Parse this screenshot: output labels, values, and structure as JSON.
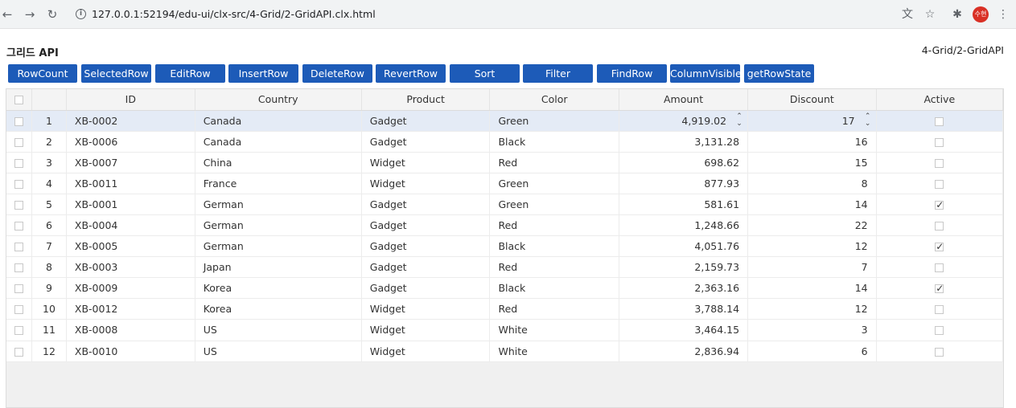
{
  "browser": {
    "url": "127.0.0.1:52194/edu-ui/clx-src/4-Grid/2-GridAPI.clx.html",
    "profile_initials": "수현",
    "icons": [
      "back-icon",
      "forward-icon",
      "reload-icon",
      "info-icon",
      "translate-icon",
      "star-icon",
      "extensions-icon",
      "menu-icon"
    ]
  },
  "page": {
    "title": "그리드 API",
    "path": "4-Grid/2-GridAPI"
  },
  "toolbar": {
    "buttons": [
      "RowCount",
      "SelectedRow",
      "EditRow",
      "InsertRow",
      "DeleteRow",
      "RevertRow",
      "Sort",
      "Filter",
      "FindRow",
      "ColumnVisible",
      "getRowState"
    ]
  },
  "grid": {
    "columns": [
      "ID",
      "Country",
      "Product",
      "Color",
      "Amount",
      "Discount",
      "Active"
    ],
    "selected_row": 1,
    "rows": [
      {
        "no": "1",
        "id": "XB-0002",
        "country": "Canada",
        "product": "Gadget",
        "color": "Green",
        "amount": "4,919.02",
        "discount": "17",
        "active": false
      },
      {
        "no": "2",
        "id": "XB-0006",
        "country": "Canada",
        "product": "Gadget",
        "color": "Black",
        "amount": "3,131.28",
        "discount": "16",
        "active": false
      },
      {
        "no": "3",
        "id": "XB-0007",
        "country": "China",
        "product": "Widget",
        "color": "Red",
        "amount": "698.62",
        "discount": "15",
        "active": false
      },
      {
        "no": "4",
        "id": "XB-0011",
        "country": "France",
        "product": "Widget",
        "color": "Green",
        "amount": "877.93",
        "discount": "8",
        "active": false
      },
      {
        "no": "5",
        "id": "XB-0001",
        "country": "German",
        "product": "Gadget",
        "color": "Green",
        "amount": "581.61",
        "discount": "14",
        "active": true
      },
      {
        "no": "6",
        "id": "XB-0004",
        "country": "German",
        "product": "Gadget",
        "color": "Red",
        "amount": "1,248.66",
        "discount": "22",
        "active": false
      },
      {
        "no": "7",
        "id": "XB-0005",
        "country": "German",
        "product": "Gadget",
        "color": "Black",
        "amount": "4,051.76",
        "discount": "12",
        "active": true
      },
      {
        "no": "8",
        "id": "XB-0003",
        "country": "Japan",
        "product": "Gadget",
        "color": "Red",
        "amount": "2,159.73",
        "discount": "7",
        "active": false
      },
      {
        "no": "9",
        "id": "XB-0009",
        "country": "Korea",
        "product": "Gadget",
        "color": "Black",
        "amount": "2,363.16",
        "discount": "14",
        "active": true
      },
      {
        "no": "10",
        "id": "XB-0012",
        "country": "Korea",
        "product": "Widget",
        "color": "Red",
        "amount": "3,788.14",
        "discount": "12",
        "active": false
      },
      {
        "no": "11",
        "id": "XB-0008",
        "country": "US",
        "product": "Widget",
        "color": "White",
        "amount": "3,464.15",
        "discount": "3",
        "active": false
      },
      {
        "no": "12",
        "id": "XB-0010",
        "country": "US",
        "product": "Widget",
        "color": "White",
        "amount": "2,836.94",
        "discount": "6",
        "active": false
      }
    ]
  }
}
